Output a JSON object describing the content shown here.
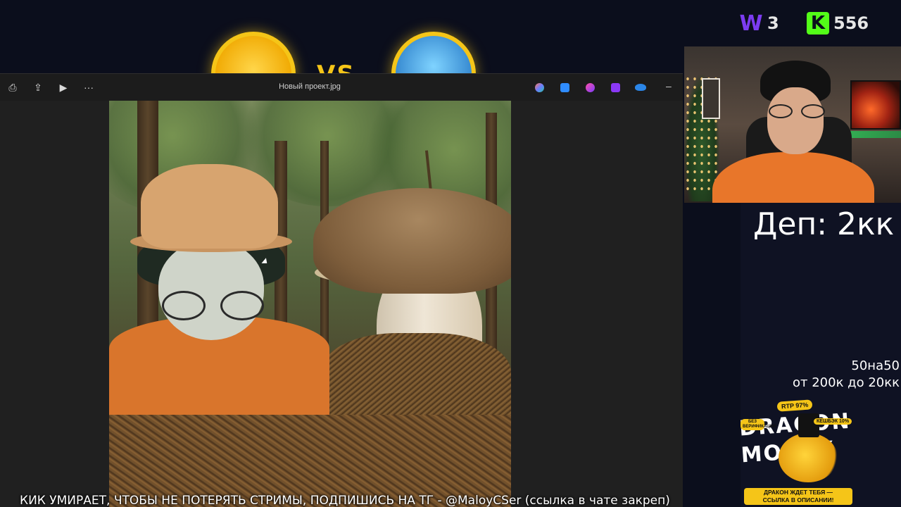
{
  "overlay": {
    "versus_label": "VS",
    "counters": {
      "w_badge": "W",
      "w_value": "3",
      "k_badge": "K",
      "k_value": "556",
      "w_color": "#7c3cf0",
      "k_color": "#53fc18"
    }
  },
  "viewer": {
    "file_title": "Новый проект.jpg",
    "toolbar_left": [
      {
        "name": "print-icon",
        "glyph": "⎙"
      },
      {
        "name": "share-icon",
        "glyph": "⇪"
      },
      {
        "name": "slideshow-icon",
        "glyph": "▶"
      },
      {
        "name": "more-icon",
        "glyph": "···"
      }
    ],
    "toolbar_right": [
      {
        "name": "copilot-icon",
        "color": "#6c7cff"
      },
      {
        "name": "edit-icon",
        "color": "#2f8cff"
      },
      {
        "name": "designer-icon",
        "color": "#c53cff"
      },
      {
        "name": "clipchamp-icon",
        "color": "#8a38f5"
      },
      {
        "name": "onedrive-icon",
        "color": "#2b86e8"
      }
    ],
    "minimize_glyph": "–"
  },
  "side": {
    "deposit": "Деп: 2кк",
    "bet_line1": "50на50",
    "bet_line2": "от 200к до 20кк"
  },
  "promo": {
    "logo_text": "DRAGON MONEY",
    "rtp": "RTP 97%",
    "cashback": "КЕШБЭК 10%",
    "verification": "БЕЗ ВЕРИФИКАЦИИ",
    "banner_line1": "ДРАКОН ЖДЕТ ТЕБЯ —",
    "banner_line2": "ССЫЛКА В ОПИСАНИИ!"
  },
  "ticker": {
    "text": "КИК УМИРАЕТ, ЧТОБЫ НЕ ПОТЕРЯТЬ СТРИМЫ, ПОДПИШИСЬ НА ТГ - @MaloyCSer (ссылка в чате закреп)"
  }
}
